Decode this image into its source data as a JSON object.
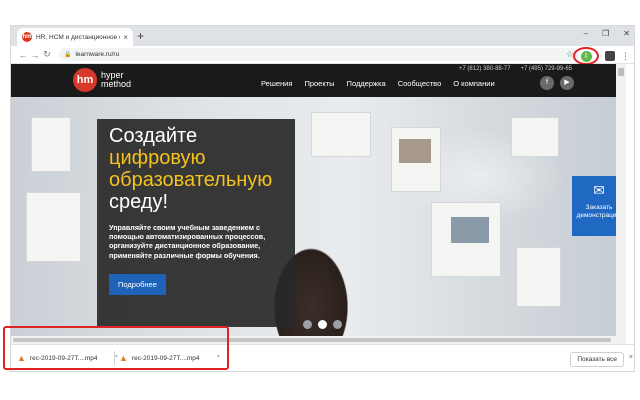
{
  "browser": {
    "tab_title": "HR, HCM и дистанционное обу...",
    "favicon_text": "hm",
    "tab_close": "×",
    "new_tab": "+",
    "window_controls": [
      "–",
      "❐",
      "✕"
    ],
    "url": "learnware.ru/ru",
    "extension_icon": "learnware-extension-icon"
  },
  "site": {
    "logo_mark": "hm",
    "logo_line1": "hyper",
    "logo_line2": "method",
    "phone1": "+7 (812) 380-88-77",
    "phone2": "+7 (495) 729-99-65",
    "menu": [
      "Решения",
      "Проекты",
      "Поддержка",
      "Сообщество",
      "О компании"
    ],
    "social": [
      "f",
      "▶"
    ],
    "hero": {
      "line1": "Создайте",
      "line2": "цифровую",
      "line3": "образовательную",
      "line4": "среду!",
      "lead": "Управляйте своим учебным заведением с помощью автоматизированных процессов, организуйте дистанционное образование, применяйте различные формы обучения.",
      "button": "Подробнее"
    },
    "demo_label": "Заказать демонстрацию",
    "carousel_active": 2,
    "carousel_count": 3
  },
  "downloads": {
    "items": [
      {
        "name": "rec-2019-09-27T....mp4"
      },
      {
        "name": "rec-2019-09-27T....mp4"
      }
    ],
    "show_all": "Показать все",
    "close": "×"
  },
  "colors": {
    "accent_red": "#e02424",
    "brand_red": "#d8382a",
    "hero_yellow": "#f5c21c",
    "button_blue": "#1f63b8"
  }
}
